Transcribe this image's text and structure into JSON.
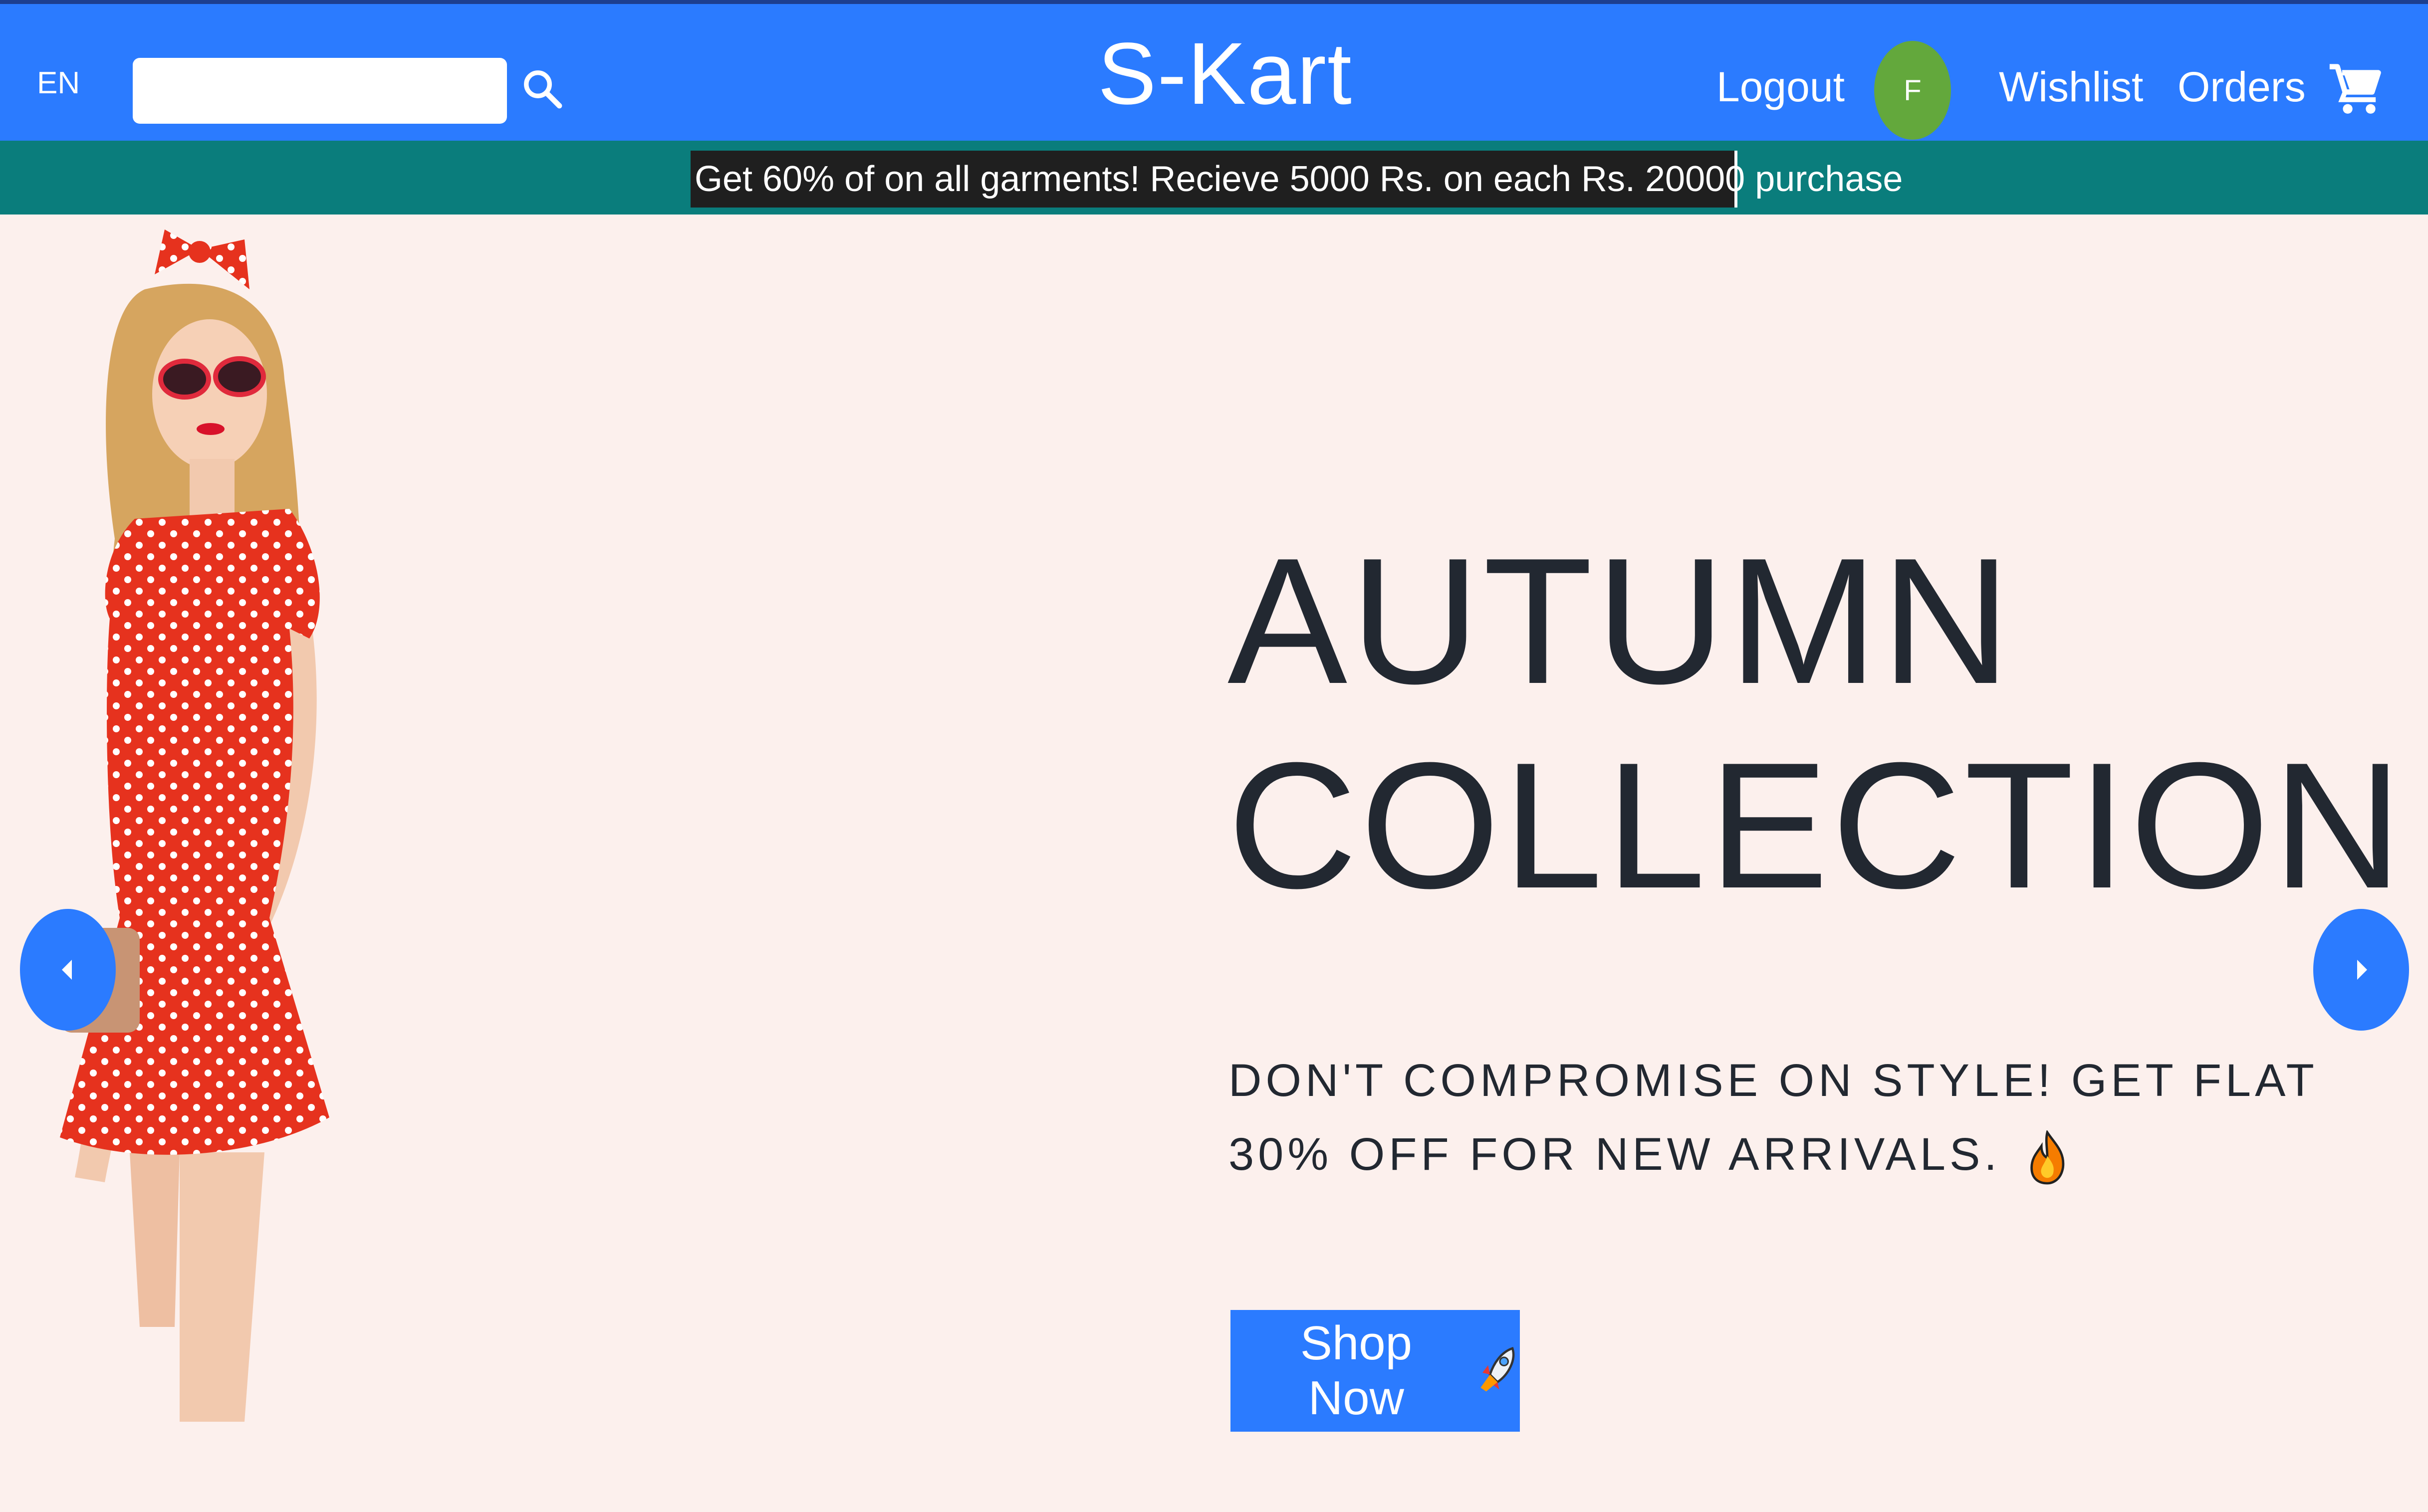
{
  "header": {
    "language": "EN",
    "search": {
      "value": "",
      "placeholder": ""
    },
    "brand": "S-Kart",
    "logout_label": "Logout",
    "avatar_initial": "F",
    "wishlist_label": "Wishlist",
    "orders_label": "Orders"
  },
  "offer": {
    "text": "Get 60% of on all garments! Recieve 5000 Rs. on each Rs. 20000 purchase"
  },
  "hero": {
    "title_line1": "AUTUMN",
    "title_line2": "COLLECTION",
    "subtitle": "DON'T COMPROMISE ON STYLE! GET FLAT 30% OFF FOR NEW ARRIVALS.",
    "cta_label": "Shop Now"
  },
  "icons": {
    "search": "search-icon",
    "cart": "cart-icon",
    "fire": "fire-icon",
    "rocket": "rocket-icon",
    "prev": "chevron-left-icon",
    "next": "chevron-right-icon"
  },
  "colors": {
    "navbar": "#2b7bff",
    "offer_strip": "#0a7d7c",
    "avatar": "#63a83c",
    "page_background": "#fcf0ed",
    "title_text": "#222831"
  }
}
